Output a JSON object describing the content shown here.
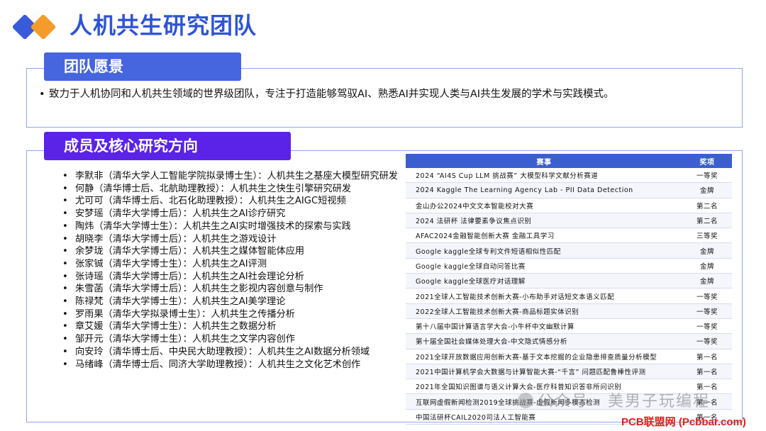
{
  "header": {
    "title": "人机共生研究团队"
  },
  "vision": {
    "heading": "团队愿景",
    "text": "致力于人机协同和人机共生领域的世界级团队，专注于打造能够驾驭AI、熟悉AI并实现人类与AI共生发展的学术与实践模式。"
  },
  "members": {
    "heading": "成员及核心研究方向",
    "items": [
      "李默非（清华大学人工智能学院拟录博士生）：人机共生之基座大模型研究研发",
      "何静（清华博士后、北航助理教授）：人机共生之快生引擎研究研发",
      "尤可可（清华博士后、北石化助理教授）：人机共生之AIGC短视频",
      "安梦瑶（清华大学博士后）：人机共生之AI诊疗研究",
      "陶炜（清华大学博士生）：人机共生之AI实时增强技术的探索与实践",
      "胡晓李（清华大学博士后）：人机共生之游戏设计",
      "余梦珑（清华大学博士后）：人机共生之媒体智能体应用",
      "张家铖（清华大学博士生）：人机共生之AI评测",
      "张诗瑶（清华大学博士后）：人机共生之AI社会理论分析",
      "朱雪菡（清华大学博士后）：人机共生之影视内容创意与制作",
      "陈禄梵（清华大学博士生）：人机共生之AI美学理论",
      "罗雨果（清华大学拟录博士生）：人机共生之传播分析",
      "章艾媛（清华大学博士生）：人机共生之数据分析",
      "邹开元（清华大学博士生）：人机共生之文学内容创作",
      "向安玲（清华博士后、中央民大助理教授）：人机共生之AI数据分析领域",
      "马绪峰（清华博士后、同济大学助理教授）：人机共生之文化艺术创作"
    ]
  },
  "awards_table": {
    "col_event": "赛事",
    "col_award": "奖项",
    "rows": [
      {
        "event": "2024 “AI4S Cup LLM 挑战赛” 大模型科学文献分析赛道",
        "award": "一等奖"
      },
      {
        "event": "2024 Kaggle The Learning Agency Lab - PII Data Detection",
        "award": "金牌"
      },
      {
        "event": "金山办公2024中文文本智能校对大赛",
        "award": "第二名"
      },
      {
        "event": "2024 法研杯 法律要素争议焦点识别",
        "award": "第二名"
      },
      {
        "event": "AFAC2024金融智能创新大赛 金融工具学习",
        "award": "三等奖"
      },
      {
        "event": "Google kaggle全球专利文件短语相似性匹配",
        "award": "金牌"
      },
      {
        "event": "Google kaggle全球自动问答比赛",
        "award": "金牌"
      },
      {
        "event": "Google kaggle全球医疗对话理解",
        "award": "金牌"
      },
      {
        "event": "2021全球人工智能技术创新大赛-小布助手对话短文本语义匹配",
        "award": "一等奖"
      },
      {
        "event": "2022全球人工智能技术创新大赛-商品标题实体识别",
        "award": "一等奖"
      },
      {
        "event": "第十八届中国计算语言学大会-小牛杯中文幽默计算",
        "award": "一等奖"
      },
      {
        "event": "第十届全国社会媒体处理大会-中文隐式情感分析",
        "award": "一等奖"
      },
      {
        "event": "2021全球开放数据应用创新大赛-基于文本挖掘的企业隐患排查质量分析模型",
        "award": "第一名"
      },
      {
        "event": "2021中国计算机学会大数据与计算智能大赛-“千言” 问题匹配鲁棒性评测",
        "award": "第一名"
      },
      {
        "event": "2021年全国知识图谱与语义计算大会-医疗科普知识答非所问识别",
        "award": "第一名"
      },
      {
        "event": "互联网虚假新闻检测2019全球挑战赛-虚假新闻多模态检测",
        "award": "第一名"
      },
      {
        "event": "中国法研杯CAIL2020司法人工智能赛",
        "award": "第一名"
      }
    ]
  },
  "watermark": {
    "text": "公众号 · 美男子玩编程"
  },
  "site_badge": {
    "text": "PCB联盟网 (Pcbbar.com)"
  }
}
